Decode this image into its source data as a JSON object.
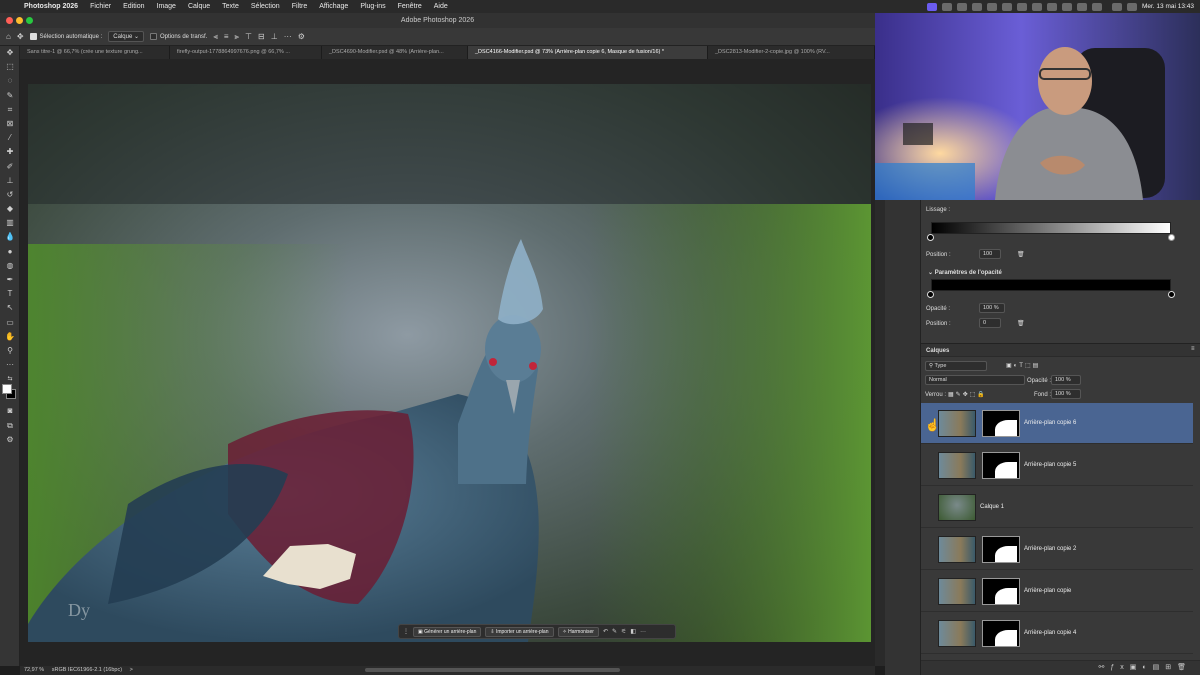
{
  "menubar": {
    "app": "Photoshop 2026",
    "items": [
      "Fichier",
      "Edition",
      "Image",
      "Calque",
      "Texte",
      "Sélection",
      "Filtre",
      "Affichage",
      "Plug-ins",
      "Fenêtre",
      "Aide"
    ],
    "clock": "Mer. 13 mai 13:43"
  },
  "window": {
    "title": "Adobe Photoshop 2026"
  },
  "options": {
    "auto_select_label": "Sélection automatique :",
    "auto_select_value": "Calque",
    "transform_label": "Options de transf."
  },
  "tabs": [
    "Sans titre-1 @ 66,7% (crée une texture grung...",
    "firefly-output-1778864997676.png @ 66,7% ...",
    "_DSC4690-Modifier.psd @ 48% (Arrière-plan...",
    "_DSC4166-Modifier.psd @ 73% (Arrière-plan copie 6, Masque de fusion/16) *",
    "_DSC2813-Modifier-2-copie.jpg @ 100% (RV..."
  ],
  "status": {
    "zoom": "72,97 %",
    "profile": "sRGB IEC61966-2.1 (16bpc)",
    "arrow": ">"
  },
  "context_bar": {
    "generate_bg": "Générer un arrière-plan",
    "import_bg": "Importer un arrière-plan",
    "harmonize": "Harmoniser"
  },
  "gradient_panel": {
    "smoothing_label": "Lissage :",
    "position_label": "Position :",
    "position_value": "100",
    "opacity_section": "Paramètres de l'opacité",
    "opacity_label": "Opacité :",
    "opacity_value": "100 %",
    "position2_label": "Position :",
    "position2_value": "0"
  },
  "layers_panel": {
    "title": "Calques",
    "filter": "Type",
    "blend_mode": "Normal",
    "opacity_label": "Opacité :",
    "opacity_value": "100 %",
    "lock_label": "Verrou :",
    "fill_label": "Fond :",
    "fill_value": "100 %",
    "layers": [
      {
        "name": "Arrière-plan copie 6",
        "selected": true,
        "has_mask": true
      },
      {
        "name": "Arrière-plan copie 5",
        "selected": false,
        "has_mask": true
      },
      {
        "name": "Calque 1",
        "selected": false,
        "has_mask": false
      },
      {
        "name": "Arrière-plan copie 2",
        "selected": false,
        "has_mask": true
      },
      {
        "name": "Arrière-plan copie",
        "selected": false,
        "has_mask": true
      },
      {
        "name": "Arrière-plan copie 4",
        "selected": false,
        "has_mask": true
      }
    ]
  },
  "colors": {
    "accent": "#4a6592",
    "panel_bg": "#393939"
  }
}
